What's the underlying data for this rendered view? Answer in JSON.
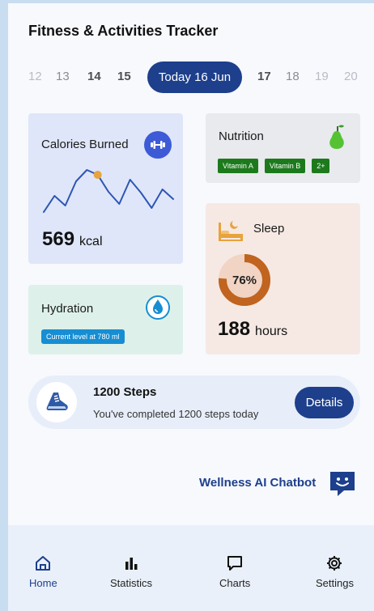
{
  "header": {
    "title": "Fitness & Activities Tracker"
  },
  "dates": {
    "before": [
      "12",
      "13",
      "14",
      "15"
    ],
    "today": "Today 16 Jun",
    "after": [
      "17",
      "18",
      "19",
      "20"
    ]
  },
  "calories": {
    "title": "Calories Burned",
    "value": "569",
    "unit": "kcal",
    "icon": "dumbbell-icon",
    "trend": [
      60,
      40,
      52,
      22,
      8,
      14,
      35,
      50,
      20,
      36,
      55,
      32,
      44
    ]
  },
  "nutrition": {
    "title": "Nutrition",
    "icon": "pear-icon",
    "tags": [
      "Vitamin A",
      "Vitamin B",
      "2+"
    ]
  },
  "hydration": {
    "title": "Hydration",
    "icon": "water-drop-icon",
    "level": "Current level at 780 ml"
  },
  "sleep": {
    "title": "Sleep",
    "icon": "bed-icon",
    "percent_label": "76%",
    "percent": 76,
    "value": "188",
    "unit": "hours"
  },
  "steps": {
    "title": "1200 Steps",
    "subtitle": "You've completed 1200 steps today",
    "button": "Details",
    "icon": "running-shoe-icon"
  },
  "chatbot": {
    "label": "Wellness AI Chatbot",
    "icon": "chatbot-icon"
  },
  "nav": {
    "items": [
      {
        "label": "Home",
        "icon": "home-icon"
      },
      {
        "label": "Statistics",
        "icon": "bar-chart-icon"
      },
      {
        "label": "Charts",
        "icon": "chat-bubble-icon"
      },
      {
        "label": "Settings",
        "icon": "gear-icon"
      }
    ]
  },
  "colors": {
    "primary": "#1d3f8c",
    "calories_bg": "#dfe6f9",
    "nutrition_bg": "#e8eaed",
    "hydration_bg": "#ddf1ea",
    "sleep_bg": "#f6e9e4",
    "sleep_ring": "#c0641f",
    "tag_green": "#1c7a1c",
    "hydration_badge": "#178ed3"
  }
}
